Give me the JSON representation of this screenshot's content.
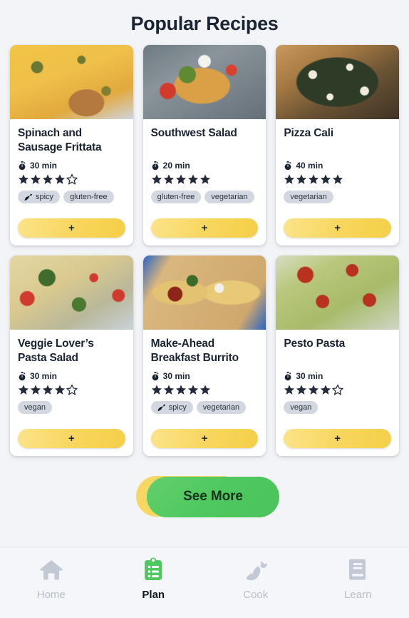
{
  "header": {
    "title": "Popular Recipes"
  },
  "recipes": [
    {
      "title": "Spinach and Sausage Frittata",
      "time": "30 min",
      "rating": 4,
      "max_rating": 5,
      "tags": [
        {
          "label": "spicy",
          "icon": "chili-pepper-icon"
        },
        {
          "label": "gluten-free",
          "icon": null
        }
      ],
      "add_label": "+",
      "photo": "spinach-sausage-frittata-photo"
    },
    {
      "title": "Southwest Salad",
      "time": "20 min",
      "rating": 5,
      "max_rating": 5,
      "tags": [
        {
          "label": "gluten-free",
          "icon": null
        },
        {
          "label": "vegetarian",
          "icon": null
        }
      ],
      "add_label": "+",
      "photo": "southwest-salad-photo"
    },
    {
      "title": "Pizza Cali",
      "time": "40 min",
      "rating": 5,
      "max_rating": 5,
      "tags": [
        {
          "label": "vegetarian",
          "icon": null
        }
      ],
      "add_label": "+",
      "photo": "pizza-cali-photo"
    },
    {
      "title": "Veggie Lover’s Pasta Salad",
      "time": "30 min",
      "rating": 4,
      "max_rating": 5,
      "tags": [
        {
          "label": "vegan",
          "icon": null
        }
      ],
      "add_label": "+",
      "photo": "veggie-lovers-pasta-salad-photo"
    },
    {
      "title": "Make-Ahead Breakfast Burrito",
      "time": "30 min",
      "rating": 5,
      "max_rating": 5,
      "tags": [
        {
          "label": "spicy",
          "icon": "chili-pepper-icon"
        },
        {
          "label": "vegetarian",
          "icon": null
        }
      ],
      "add_label": "+",
      "photo": "make-ahead-breakfast-burrito-photo"
    },
    {
      "title": "Pesto Pasta",
      "time": "30 min",
      "rating": 4,
      "max_rating": 5,
      "tags": [
        {
          "label": "vegan",
          "icon": null
        }
      ],
      "add_label": "+",
      "photo": "pesto-pasta-photo"
    }
  ],
  "see_more": {
    "label": "See More"
  },
  "bottom_nav": {
    "items": [
      {
        "label": "Home",
        "icon": "house-icon",
        "active": false
      },
      {
        "label": "Plan",
        "icon": "clipboard-icon",
        "active": true
      },
      {
        "label": "Cook",
        "icon": "carrot-icon",
        "active": false
      },
      {
        "label": "Learn",
        "icon": "book-icon",
        "active": false
      }
    ]
  },
  "colors": {
    "background": "#f2f4f7",
    "card": "#ffffff",
    "text": "#1b2433",
    "accent_yellow": "#f6d45c",
    "accent_green": "#4fc85f",
    "tag": "#d3d8e0",
    "nav_inactive": "#b7bec9"
  }
}
